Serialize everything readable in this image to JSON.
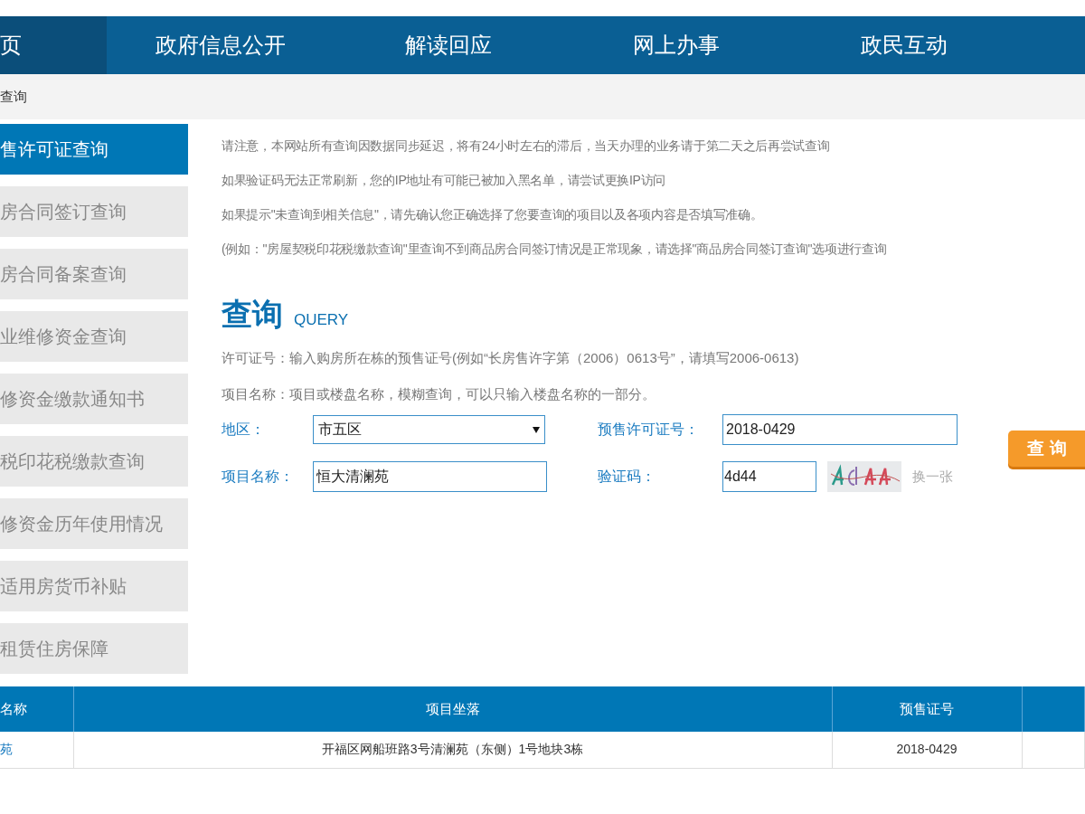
{
  "nav": [
    {
      "label": "页",
      "selected": true
    },
    {
      "label": "政府信息公开",
      "selected": false
    },
    {
      "label": "解读回应",
      "selected": false
    },
    {
      "label": "网上办事",
      "selected": false
    },
    {
      "label": "政民互动",
      "selected": false
    }
  ],
  "breadcrumb": "查询",
  "sidebar": {
    "items": [
      {
        "label": "售许可证查询",
        "selected": true
      },
      {
        "label": "房合同签订查询",
        "selected": false
      },
      {
        "label": "房合同备案查询",
        "selected": false
      },
      {
        "label": "业维修资金查询",
        "selected": false
      },
      {
        "label": "修资金缴款通知书",
        "selected": false
      },
      {
        "label": "税印花税缴款查询",
        "selected": false
      },
      {
        "label": "修资金历年使用情况",
        "selected": false
      },
      {
        "label": "适用房货币补贴",
        "selected": false
      },
      {
        "label": "租赁住房保障",
        "selected": false
      }
    ]
  },
  "notices": [
    "请注意，本网站所有查询因数据同步延迟，将有24小时左右的滞后，当天办理的业务请于第二天之后再尝试查询",
    "如果验证码无法正常刷新，您的IP地址有可能已被加入黑名单，请尝试更换IP访问",
    "如果提示\"未查询到相关信息\"，请先确认您正确选择了您要查询的项目以及各项内容是否填写准确。",
    "(例如：\"房屋契税印花税缴款查询\"里查询不到商品房合同签订情况是正常现象，请选择\"商品房合同签订查询\"选项进行查询"
  ],
  "query": {
    "title": "查询",
    "subtitle": "QUERY",
    "hints": [
      "许可证号：输入购房所在栋的预售证号(例如“长房售许字第（2006）0613号”，请填写2006-0613)",
      "项目名称：项目或楼盘名称，模糊查询，可以只输入楼盘名称的一部分。"
    ],
    "region": {
      "label": "地区：",
      "value": "市五区"
    },
    "permit": {
      "label": "预售许可证号：",
      "value": "2018-0429"
    },
    "project": {
      "label": "项目名称：",
      "value": "恒大清澜苑"
    },
    "captcha": {
      "label": "验证码：",
      "value": "4d44",
      "refresh": "换一张"
    },
    "submit": "查 询"
  },
  "table": {
    "columns": [
      "名称",
      "项目坐落",
      "预售证号"
    ],
    "rows": [
      [
        "苑",
        "开福区网船班路3号清澜苑（东侧）1号地块3栋",
        "2018-0429"
      ]
    ]
  }
}
